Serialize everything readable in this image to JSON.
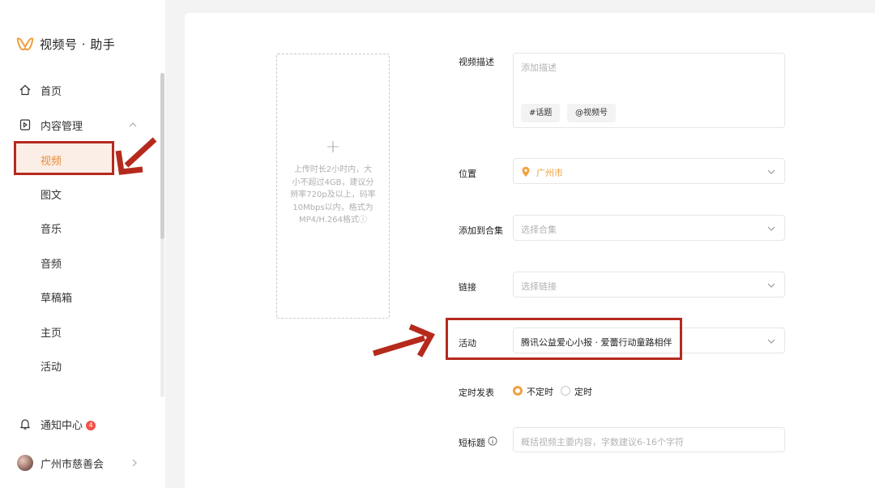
{
  "app": {
    "title": "视频号 · 助手"
  },
  "sidebar": {
    "home": "首页",
    "content_mgmt": "内容管理",
    "sub_items": [
      "视频",
      "图文",
      "音乐",
      "音频",
      "草稿箱",
      "主页",
      "活动"
    ],
    "notification": "通知中心",
    "notification_badge": "4",
    "account": "广州市慈善会"
  },
  "upload": {
    "plus": "+",
    "hint": "上传时长2小时内，大小不超过4GB，建议分辨率720p及以上，码率10Mbps以内，格式为MP4/H.264格式ⓘ"
  },
  "form": {
    "description": {
      "label": "视频描述",
      "placeholder": "添加描述",
      "chip_topic": "#话题",
      "chip_channel": "@视频号"
    },
    "location": {
      "label": "位置",
      "value": "广州市"
    },
    "collection": {
      "label": "添加到合集",
      "placeholder": "选择合集"
    },
    "link": {
      "label": "链接",
      "placeholder": "选择链接"
    },
    "activity": {
      "label": "活动",
      "value": "腾讯公益爱心小报 · 爱蕾行动童路相伴"
    },
    "schedule": {
      "label": "定时发表",
      "option_no": "不定时",
      "option_yes": "定时",
      "selected": "不定时"
    },
    "short_title": {
      "label": "短标题",
      "placeholder": "概括视频主要内容，字数建议6-16个字符"
    }
  },
  "colors": {
    "accent": "#f0a040",
    "highlight_red": "#b52a1d",
    "badge": "#f0524a"
  }
}
